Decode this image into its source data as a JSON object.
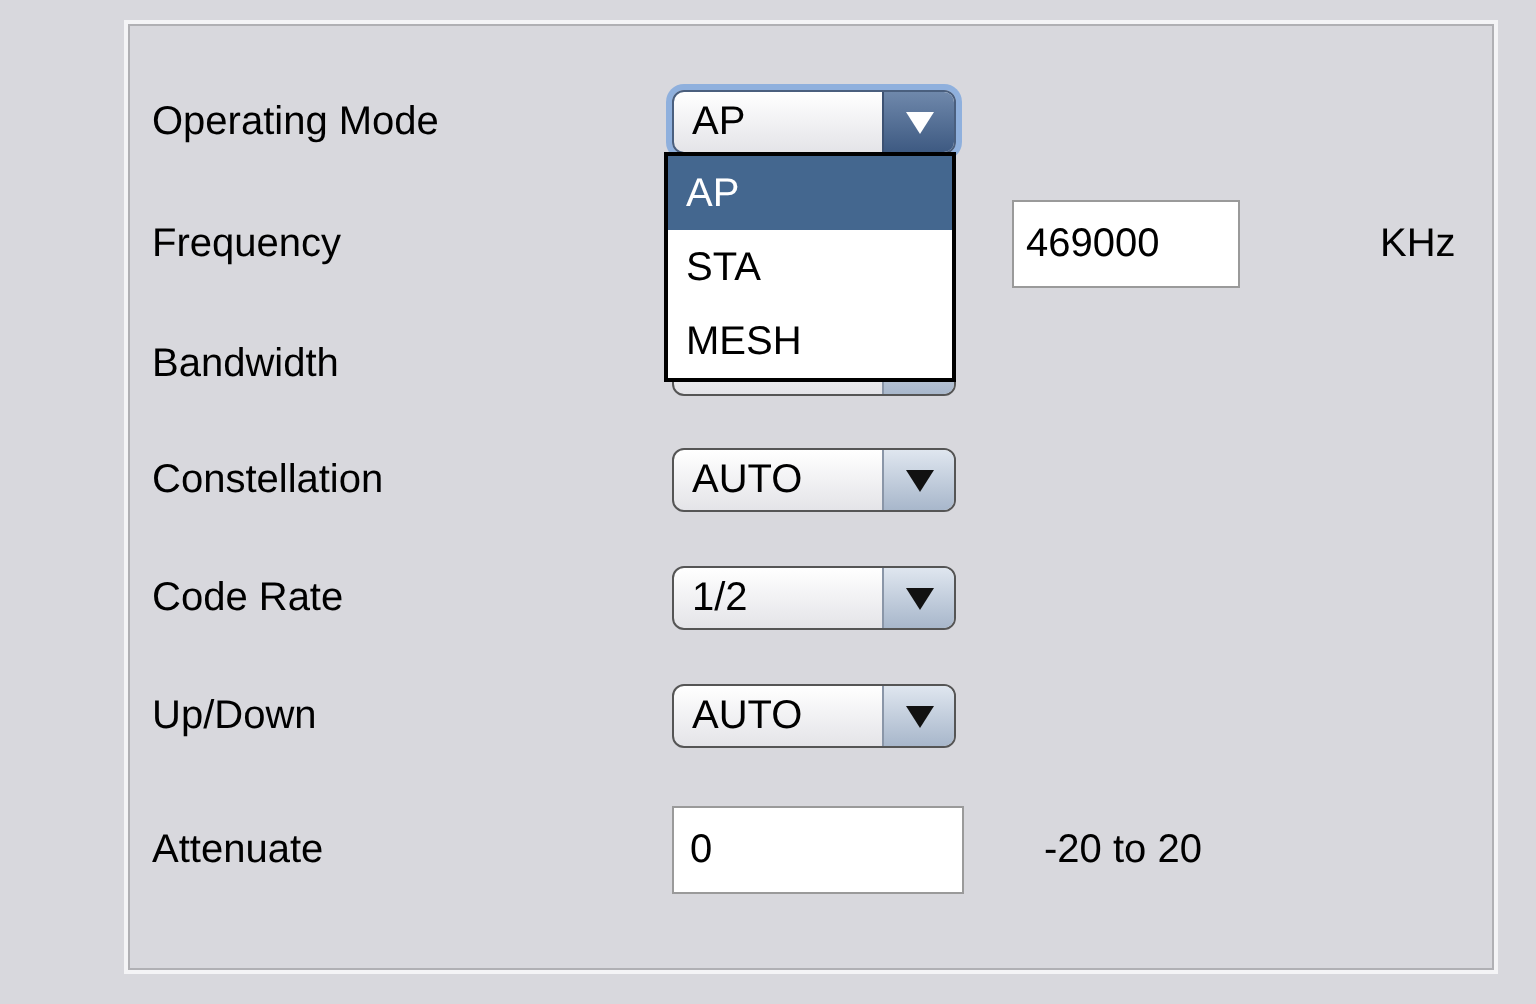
{
  "rows": [
    {
      "kind": "combo",
      "label": "Operating Mode",
      "value": "AP",
      "expanded": true,
      "options": [
        {
          "label": "AP",
          "selected": true
        },
        {
          "label": "STA",
          "selected": false
        },
        {
          "label": "MESH",
          "selected": false
        }
      ]
    },
    {
      "kind": "field",
      "label": "Frequency",
      "value": "469000",
      "unit": "KHz"
    },
    {
      "kind": "combo",
      "label": "Bandwidth",
      "expanded": false
    },
    {
      "kind": "combo",
      "label": "Constellation",
      "value": "AUTO",
      "expanded": false
    },
    {
      "kind": "combo",
      "label": "Code Rate",
      "value": "1/2",
      "expanded": false
    },
    {
      "kind": "combo",
      "label": "Up/Down",
      "value": "AUTO",
      "expanded": false
    },
    {
      "kind": "text",
      "label": "Attenuate",
      "value": "0",
      "unit": "-20 to 20"
    }
  ]
}
